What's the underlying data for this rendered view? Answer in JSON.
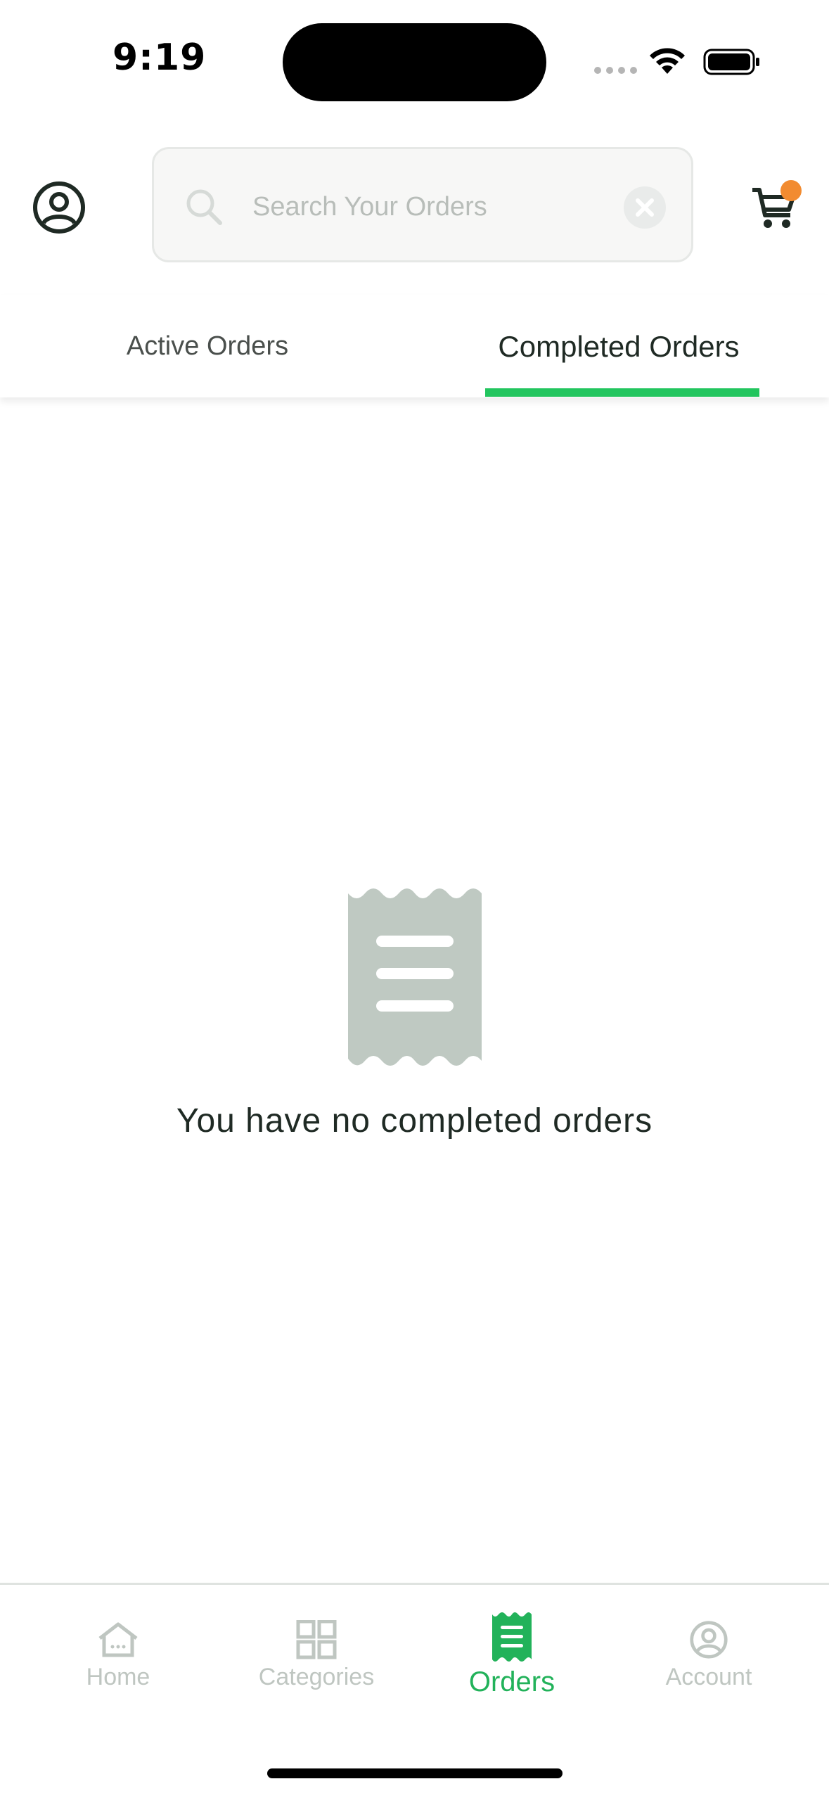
{
  "status_bar": {
    "time": "9:19"
  },
  "header": {
    "search": {
      "placeholder": "Search Your Orders",
      "value": ""
    },
    "cart_badge_color": "#f28b30"
  },
  "tabs": {
    "items": [
      {
        "label": "Active Orders",
        "active": false
      },
      {
        "label": "Completed Orders",
        "active": true
      }
    ],
    "active_color": "#22c55e"
  },
  "empty_state": {
    "icon": "receipt-icon",
    "message": "You have no completed orders"
  },
  "bottom_nav": {
    "items": [
      {
        "label": "Home",
        "icon": "home-icon",
        "active": false
      },
      {
        "label": "Categories",
        "icon": "grid-icon",
        "active": false
      },
      {
        "label": "Orders",
        "icon": "receipt-icon",
        "active": true
      },
      {
        "label": "Account",
        "icon": "user-circle-icon",
        "active": false
      }
    ],
    "active_color": "#22b25a",
    "inactive_color": "#bfc6c1"
  }
}
